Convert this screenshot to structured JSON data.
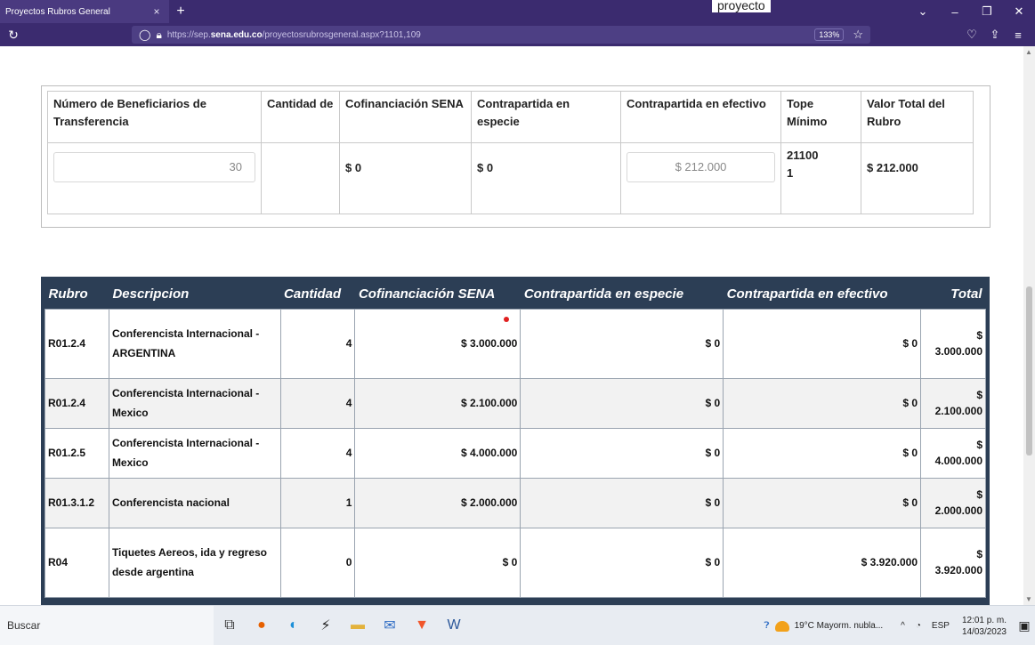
{
  "browser": {
    "tab_title": "Proyectos Rubros General",
    "tab_close": "×",
    "new_tab": "+",
    "page_heading_fragment": "proyecto",
    "url_plain": "https://sep.",
    "url_domain": "sena.edu.co",
    "url_path": "/proyectosrubrosgeneral.aspx?1101,109",
    "zoom": "133%"
  },
  "top_table": {
    "headers": [
      "Número de Beneficiarios de Transferencia",
      "Cantidad de",
      "Cofinanciación SENA",
      "Contrapartida en especie",
      "Contrapartida en efectivo",
      "Tope Mínimo",
      "Valor Total del Rubro"
    ],
    "beneficiarios_value": "30",
    "cantidad": "",
    "cofinanciacion": "$ 0",
    "especie": "$ 0",
    "efectivo_value": "$ 212.000",
    "tope_line1": "21100",
    "tope_line2": "1",
    "valor_total": "$ 212.000"
  },
  "rubros_table": {
    "headers": [
      "Rubro",
      "Descripcion",
      "Cantidad",
      "Cofinanciación SENA",
      "Contrapartida en especie",
      "Contrapartida en efectivo",
      "Total"
    ],
    "rows": [
      {
        "rubro": "R01.2.4",
        "descripcion": "Conferencista Internacional - ARGENTINA",
        "cantidad": "4",
        "cofinanciacion": "$ 3.000.000",
        "especie": "$ 0",
        "efectivo": "$ 0",
        "total_symbol": "$",
        "total_value": "3.000.000"
      },
      {
        "rubro": "R01.2.4",
        "descripcion": "Conferencista Internacional - Mexico",
        "cantidad": "4",
        "cofinanciacion": "$ 2.100.000",
        "especie": "$ 0",
        "efectivo": "$ 0",
        "total_symbol": "$",
        "total_value": "2.100.000"
      },
      {
        "rubro": "R01.2.5",
        "descripcion": "Conferencista Internacional - Mexico",
        "cantidad": "4",
        "cofinanciacion": "$ 4.000.000",
        "especie": "$ 0",
        "efectivo": "$ 0",
        "total_symbol": "$",
        "total_value": "4.000.000"
      },
      {
        "rubro": "R01.3.1.2",
        "descripcion": "Conferencista nacional",
        "cantidad": "1",
        "cofinanciacion": "$ 2.000.000",
        "especie": "$ 0",
        "efectivo": "$ 0",
        "total_symbol": "$",
        "total_value": "2.000.000"
      },
      {
        "rubro": "R04",
        "descripcion": "Tiquetes Aereos, ida y regreso desde argentina",
        "cantidad": "0",
        "cofinanciacion": "$ 0",
        "especie": "$ 0",
        "efectivo": "$ 3.920.000",
        "total_symbol": "$",
        "total_value": "3.920.000"
      }
    ]
  },
  "taskbar": {
    "search_placeholder": "Buscar",
    "weather": "19°C  Mayorm. nubla...",
    "language": "ESP",
    "time": "12:01 p. m.",
    "date": "14/03/2023"
  },
  "colors": {
    "titlebar": "#3b2b6f",
    "table_header_bg": "#2c3e55",
    "marker": "#e02020"
  }
}
